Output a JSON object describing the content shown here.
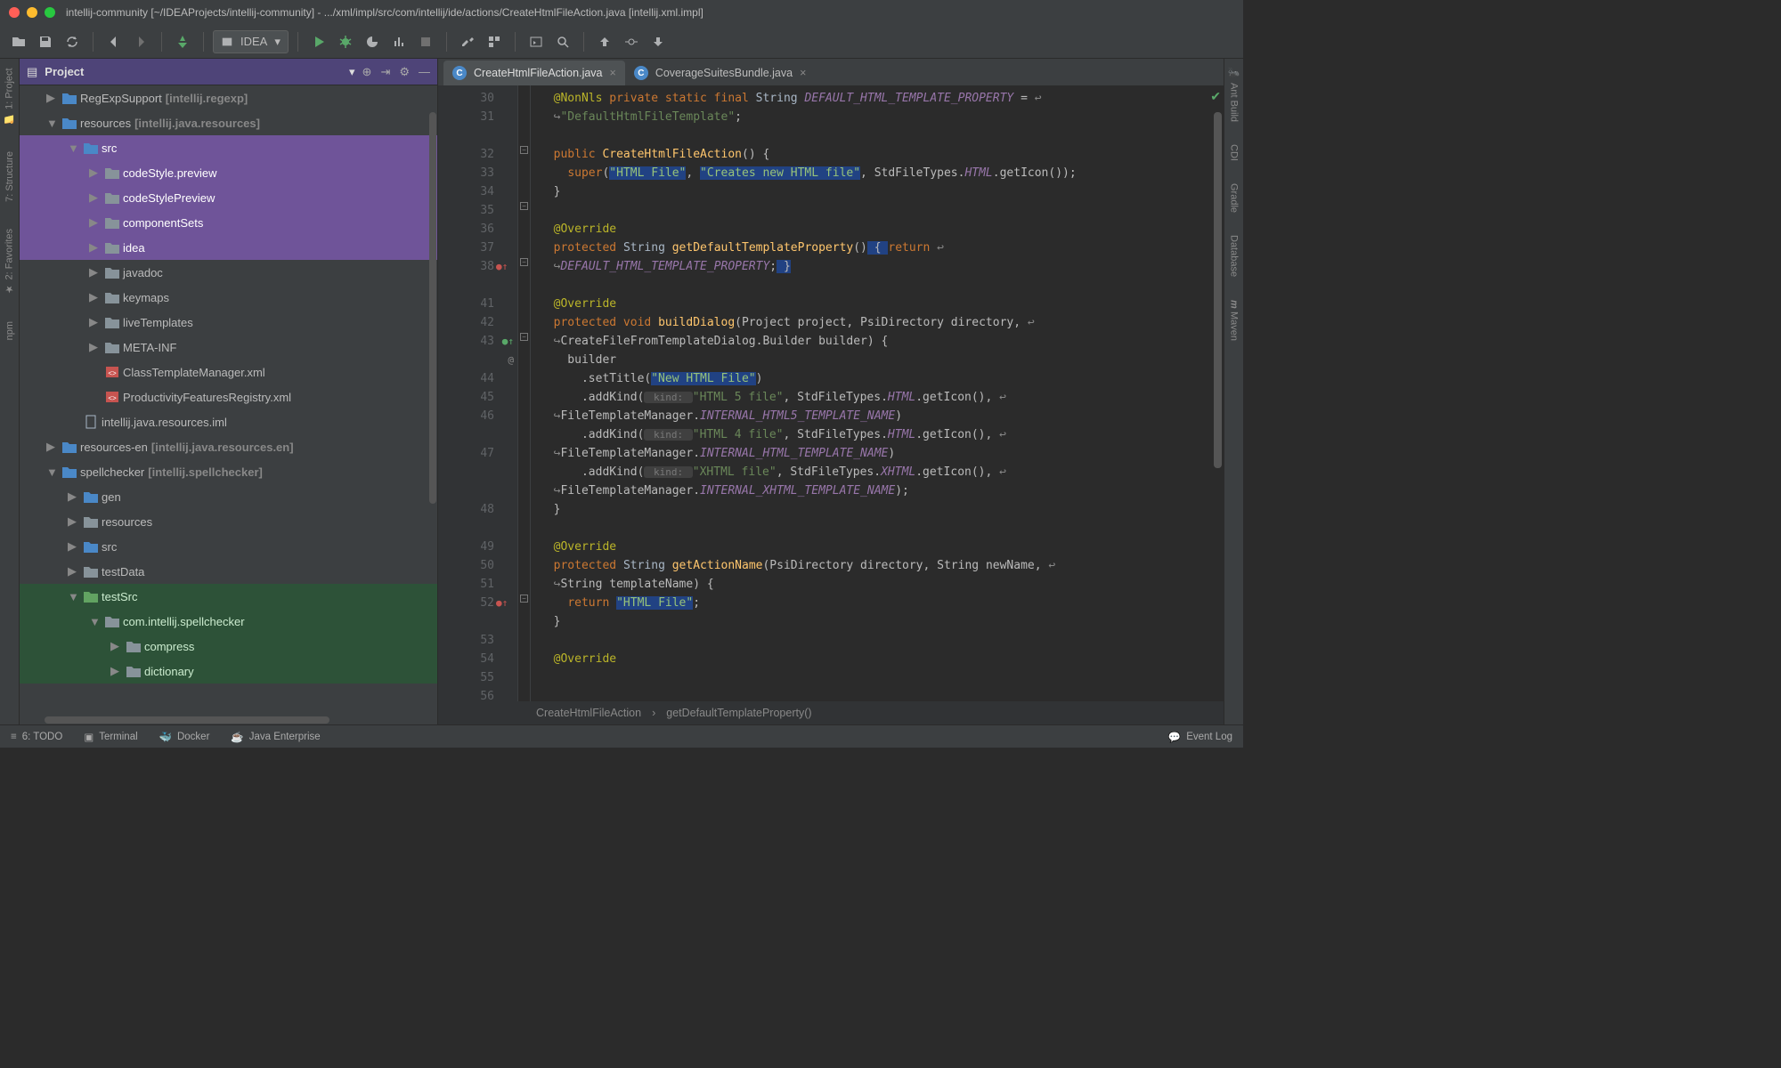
{
  "title": "intellij-community [~/IDEAProjects/intellij-community] - .../xml/impl/src/com/intellij/ide/actions/CreateHtmlFileAction.java [intellij.xml.impl]",
  "runConfig": "IDEA",
  "projectPanel": {
    "title": "Project"
  },
  "leftTools": [
    "1: Project",
    "7: Structure",
    "2: Favorites",
    "npm"
  ],
  "rightTools": [
    "Ant Build",
    "CDI",
    "Gradle",
    "Database",
    "Maven"
  ],
  "tree": [
    {
      "i": 1,
      "arrow": "▶",
      "iconType": "dir-blue",
      "label": "RegExpSupport",
      "ctx": "[intellij.regexp]"
    },
    {
      "i": 1,
      "arrow": "▼",
      "iconType": "dir-blue",
      "label": "resources",
      "ctx": "[intellij.java.resources]"
    },
    {
      "i": 2,
      "arrow": "▼",
      "iconType": "dir-blue",
      "label": "src",
      "sel": "purple"
    },
    {
      "i": 3,
      "arrow": "▶",
      "iconType": "dir-pkg",
      "label": "codeStyle.preview",
      "sel": "purple"
    },
    {
      "i": 3,
      "arrow": "▶",
      "iconType": "dir-pkg",
      "label": "codeStylePreview",
      "sel": "purple"
    },
    {
      "i": 3,
      "arrow": "▶",
      "iconType": "dir-pkg",
      "label": "componentSets",
      "sel": "purple"
    },
    {
      "i": 3,
      "arrow": "▶",
      "iconType": "dir-pkg",
      "label": "idea",
      "sel": "purple"
    },
    {
      "i": 3,
      "arrow": "▶",
      "iconType": "dir-pkg",
      "label": "javadoc"
    },
    {
      "i": 3,
      "arrow": "▶",
      "iconType": "dir-pkg",
      "label": "keymaps"
    },
    {
      "i": 3,
      "arrow": "▶",
      "iconType": "dir-pkg",
      "label": "liveTemplates"
    },
    {
      "i": 3,
      "arrow": "▶",
      "iconType": "dir-pkg",
      "label": "META-INF"
    },
    {
      "i": 3,
      "arrow": "",
      "iconType": "xml",
      "label": "ClassTemplateManager.xml"
    },
    {
      "i": 3,
      "arrow": "",
      "iconType": "xml",
      "label": "ProductivityFeaturesRegistry.xml"
    },
    {
      "i": 2,
      "arrow": "",
      "iconType": "iml",
      "label": "intellij.java.resources.iml"
    },
    {
      "i": 1,
      "arrow": "▶",
      "iconType": "dir-blue",
      "label": "resources-en",
      "ctx": "[intellij.java.resources.en]"
    },
    {
      "i": 1,
      "arrow": "▼",
      "iconType": "dir-blue",
      "label": "spellchecker",
      "ctx": "[intellij.spellchecker]"
    },
    {
      "i": 2,
      "arrow": "▶",
      "iconType": "dir-blue",
      "label": "gen"
    },
    {
      "i": 2,
      "arrow": "▶",
      "iconType": "dir-pkg",
      "label": "resources"
    },
    {
      "i": 2,
      "arrow": "▶",
      "iconType": "dir-blue",
      "label": "src"
    },
    {
      "i": 2,
      "arrow": "▶",
      "iconType": "dir-pkg",
      "label": "testData"
    },
    {
      "i": 2,
      "arrow": "▼",
      "iconType": "dir-green",
      "label": "testSrc",
      "sel": "green"
    },
    {
      "i": 3,
      "arrow": "▼",
      "iconType": "dir-pkg",
      "label": "com.intellij.spellchecker",
      "sel": "green"
    },
    {
      "i": 4,
      "arrow": "▶",
      "iconType": "dir-pkg",
      "label": "compress",
      "sel": "green"
    },
    {
      "i": 4,
      "arrow": "▶",
      "iconType": "dir-pkg",
      "label": "dictionary",
      "sel": "green"
    }
  ],
  "tabs": [
    {
      "label": "CreateHtmlFileAction.java",
      "active": true
    },
    {
      "label": "CoverageSuitesBundle.java",
      "active": false
    }
  ],
  "gutterLines": [
    "30",
    "31",
    "",
    "32",
    "33",
    "34",
    "35",
    "36",
    "37",
    "38",
    "",
    "41",
    "42",
    "43",
    "",
    "44",
    "45",
    "46",
    "",
    "47",
    "",
    "",
    "48",
    "",
    "49",
    "50",
    "51",
    "52",
    "",
    "53",
    "54",
    "55",
    "56"
  ],
  "code": {
    "l1": {
      "a": "@NonNls",
      "b": " private static final ",
      "c": "String ",
      "d": "DEFAULT_HTML_TEMPLATE_PROPERTY",
      "e": " = "
    },
    "l2": {
      "a": "\"DefaultHtmlFileTemplate\"",
      "b": ";"
    },
    "l3": "",
    "l4": {
      "a": "public ",
      "b": "CreateHtmlFileAction",
      "c": "() {"
    },
    "l5": {
      "a": "super",
      "b": "(",
      "c": "\"HTML File\"",
      "d": ", ",
      "e": "\"Creates new HTML file\"",
      "f": ", StdFileTypes.",
      "g": "HTML",
      "h": ".getIcon());"
    },
    "l6": "}",
    "l7": "",
    "l8": "@Override",
    "l9": {
      "a": "protected ",
      "b": "String ",
      "c": "getDefaultTemplateProperty",
      "d": "()",
      "e": " { ",
      "f": "return"
    },
    "l10": {
      "a": "DEFAULT_HTML_TEMPLATE_PROPERTY",
      "b": ";",
      "c": " }"
    },
    "l11": "",
    "l12": "@Override",
    "l13": {
      "a": "protected void ",
      "b": "buildDialog",
      "c": "(Project project, PsiDirectory directory, "
    },
    "l14": {
      "a": "CreateFileFromTemplateDialog.Builder builder) {"
    },
    "l15": "builder",
    "l16": {
      "a": ".setTitle(",
      "b": "\"New HTML File\"",
      "c": ")"
    },
    "l17": {
      "a": ".addKind(",
      "h": " kind: ",
      "b": "\"HTML 5 file\"",
      "c": ", StdFileTypes.",
      "d": "HTML",
      "e": ".getIcon(), "
    },
    "l18": {
      "a": "FileTemplateManager.",
      "b": "INTERNAL_HTML5_TEMPLATE_NAME",
      "c": ")"
    },
    "l19": {
      "a": ".addKind(",
      "h": " kind: ",
      "b": "\"HTML 4 file\"",
      "c": ", StdFileTypes.",
      "d": "HTML",
      "e": ".getIcon(), "
    },
    "l20": {
      "a": "FileTemplateManager.",
      "b": "INTERNAL_HTML_TEMPLATE_NAME",
      "c": ")"
    },
    "l21": {
      "a": ".addKind(",
      "h": " kind: ",
      "b": "\"XHTML file\"",
      "c": ", StdFileTypes.",
      "d": "XHTML",
      "e": ".getIcon(), "
    },
    "l22": {
      "a": "FileTemplateManager.",
      "b": "INTERNAL_XHTML_TEMPLATE_NAME",
      "c": ");"
    },
    "l23": "}",
    "l24": "",
    "l25": "@Override",
    "l26": {
      "a": "protected ",
      "b": "String ",
      "c": "getActionName",
      "d": "(PsiDirectory directory, String newName, "
    },
    "l27": {
      "a": "String templateName) {"
    },
    "l28": {
      "a": "return ",
      "b": "\"HTML File\"",
      "c": ";"
    },
    "l29": "}",
    "l30": "",
    "l31": "@Override"
  },
  "breadcrumb": [
    "CreateHtmlFileAction",
    "getDefaultTemplateProperty()"
  ],
  "bottomTools": {
    "todo": "6: TODO",
    "terminal": "Terminal",
    "docker": "Docker",
    "java": "Java Enterprise",
    "eventlog": "Event Log"
  }
}
